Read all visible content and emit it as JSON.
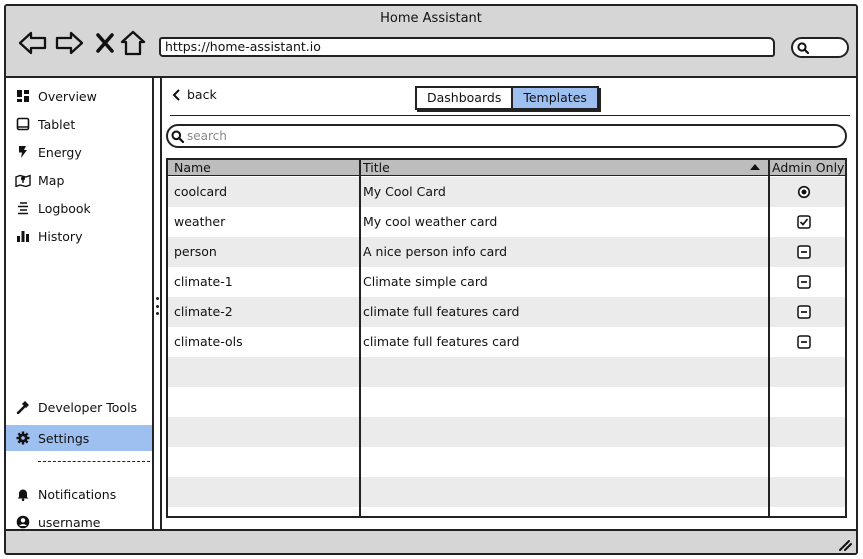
{
  "app": {
    "title": "Home Assistant"
  },
  "browser": {
    "url": "https://home-assistant.io"
  },
  "sidebar": {
    "items": [
      {
        "label": "Overview",
        "icon": "dashboard-icon"
      },
      {
        "label": "Tablet",
        "icon": "tablet-icon"
      },
      {
        "label": "Energy",
        "icon": "lightning-icon"
      },
      {
        "label": "Map",
        "icon": "map-icon"
      },
      {
        "label": "Logbook",
        "icon": "list-icon"
      },
      {
        "label": "History",
        "icon": "bar-chart-icon"
      }
    ],
    "bottom_items": [
      {
        "label": "Developer Tools",
        "icon": "hammer-icon"
      },
      {
        "label": "Settings",
        "icon": "gear-icon",
        "active": true
      }
    ],
    "footer_items": [
      {
        "label": "Notifications",
        "icon": "bell-icon"
      },
      {
        "label": "username",
        "icon": "user-icon"
      }
    ]
  },
  "main": {
    "back_label": "back",
    "tabs": [
      {
        "label": "Dashboards",
        "selected": false
      },
      {
        "label": "Templates",
        "selected": true
      }
    ],
    "search_placeholder": "search",
    "table": {
      "columns": [
        "Name",
        "Title",
        "Admin Only"
      ],
      "sort_column": "Title",
      "rows": [
        {
          "name": "coolcard",
          "title": "My Cool Card",
          "admin": "radio-selected"
        },
        {
          "name": "weather",
          "title": "My cool weather card",
          "admin": "checked"
        },
        {
          "name": "person",
          "title": "A nice person info card",
          "admin": "indeterminate"
        },
        {
          "name": "climate-1",
          "title": "Climate simple card",
          "admin": "indeterminate"
        },
        {
          "name": "climate-2",
          "title": "climate full features card",
          "admin": "indeterminate"
        },
        {
          "name": "climate-ols",
          "title": "climate full features card",
          "admin": "indeterminate"
        }
      ]
    }
  },
  "colors": {
    "accent": "#9ec0f1",
    "chrome": "#d6d6d6",
    "row_alt": "#ebebeb",
    "header": "#bdbdbd"
  }
}
